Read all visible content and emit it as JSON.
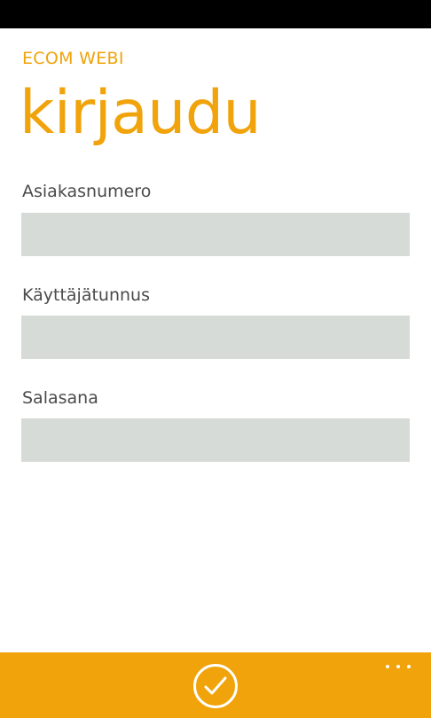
{
  "app": {
    "name": "ECOM WEBI"
  },
  "page": {
    "title": "kirjaudu"
  },
  "form": {
    "fields": [
      {
        "label": "Asiakasnumero",
        "value": "",
        "placeholder": ""
      },
      {
        "label": "Käyttäjätunnus",
        "value": "",
        "placeholder": ""
      },
      {
        "label": "Salasana",
        "value": "",
        "placeholder": ""
      }
    ]
  },
  "app_bar": {
    "confirm_icon": "check-icon",
    "more_icon": "more-ellipsis-icon"
  },
  "colors": {
    "accent": "#f0a30a",
    "input_background": "#d6dbd7",
    "status_bar": "#000000"
  }
}
